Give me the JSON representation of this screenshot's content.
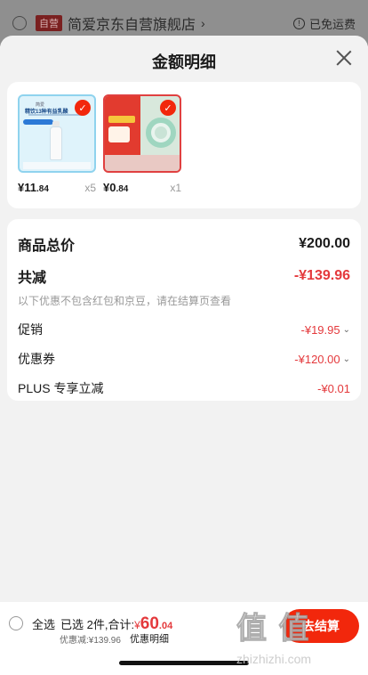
{
  "store": {
    "self_operated_tag": "自营",
    "name": "简爱京东自营旗舰店",
    "chevron": "›",
    "shipping": "已免运费"
  },
  "sheet": {
    "title": "金额明细"
  },
  "products": [
    {
      "price_main": "¥11",
      "price_dec": ".84",
      "qty": "x5",
      "thumb_heading": "精饮13种有益乳酸",
      "thumb_top": "简爱"
    },
    {
      "price_main": "¥0",
      "price_dec": ".84",
      "qty": "x1"
    }
  ],
  "summary": {
    "total_label": "商品总价",
    "total_value": "¥200.00",
    "reduce_label": "共减",
    "reduce_value": "-¥139.96",
    "note": "以下优惠不包含红包和京豆，请在结算页查看",
    "items": [
      {
        "label": "促销",
        "value": "-¥19.95",
        "arrow": "⌄"
      },
      {
        "label": "优惠券",
        "value": "-¥120.00",
        "arrow": "⌄"
      },
      {
        "label": "PLUS 专享立减",
        "value": "-¥0.01",
        "arrow": ""
      }
    ]
  },
  "bottom": {
    "select_all": "全选",
    "selected_text": "已选 2件,合计:",
    "sum_yen": "¥",
    "sum_int": "60",
    "sum_dec": ".04",
    "discount_line": "优惠减:¥139.96",
    "detail_link": "优惠明细",
    "checkout": "去结算"
  },
  "watermark": {
    "logo": "值 值",
    "url": "zhizhizhi.com"
  },
  "colors": {
    "accent_red": "#e4393c",
    "button_red": "#f2270c"
  }
}
